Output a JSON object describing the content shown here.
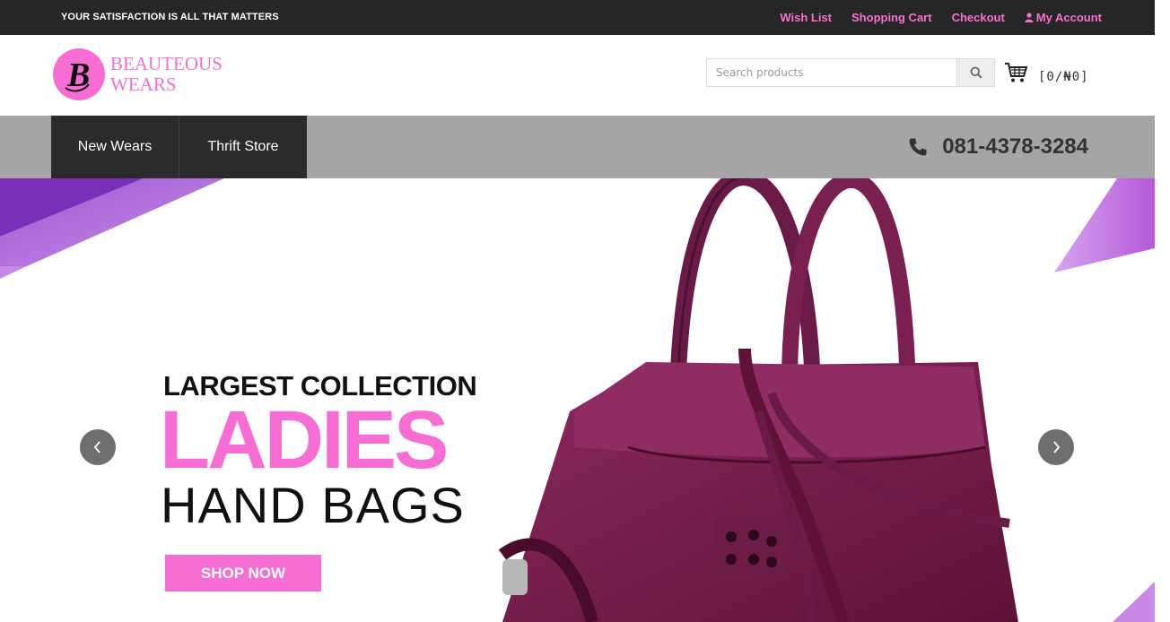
{
  "topbar": {
    "tagline": "YOUR SATISFACTION IS ALL THAT MATTERS",
    "links": [
      {
        "label": "Wish List"
      },
      {
        "label": "Shopping Cart"
      },
      {
        "label": "Checkout"
      },
      {
        "label": "My Account",
        "icon": "user-icon"
      }
    ]
  },
  "logo": {
    "mark": "B",
    "line1": "BEAUTEOUS",
    "line2": "WEARS"
  },
  "search": {
    "placeholder": "Search products",
    "icon": "search-icon"
  },
  "cart": {
    "icon": "cart-icon",
    "total": "[0/₦0]"
  },
  "nav": {
    "items": [
      {
        "label": "New Wears"
      },
      {
        "label": "Thrift Store"
      }
    ],
    "phone": "081-4378-3284",
    "phone_icon": "phone-icon"
  },
  "hero": {
    "line1": "LARGEST COLLECTION",
    "line2": "LADIES",
    "line3": "HAND BAGS",
    "cta": "SHOP NOW",
    "prev_icon": "chevron-left-icon",
    "next_icon": "chevron-right-icon",
    "image": "purple-handbag"
  },
  "colors": {
    "accent_pink": "#f66ed3",
    "link_pink": "#f472d0",
    "topbar_bg": "#262626",
    "nav_bg": "#a5a5a5",
    "nav_menu_bg": "#2b2b2b",
    "bag_purple": "#7a2050"
  }
}
